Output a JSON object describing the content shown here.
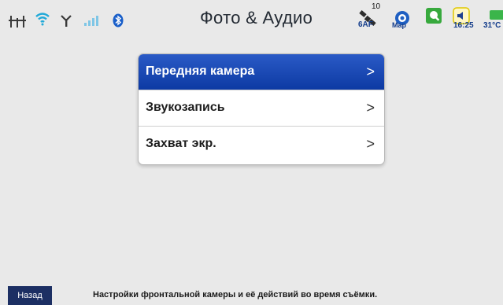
{
  "statusbar": {
    "title": "Фото & Аудио",
    "icons": {
      "ethernet": "ethernet-icon",
      "wifi": "wifi-icon",
      "antenna": "antenna-icon",
      "signal": "signal-icon",
      "bluetooth": "bluetooth-icon",
      "satellite": "satellite-icon",
      "map": "map-icon",
      "app": "green-app-icon",
      "volume": "volume-icon",
      "battery": "battery-icon"
    },
    "satellite_count": "10",
    "satellite_label": "6AF",
    "map_label": "Map",
    "time": "16:25",
    "temperature": "31°C"
  },
  "menu": {
    "items": [
      {
        "label": "Передняя камера",
        "chevron": ">"
      },
      {
        "label": "Звукозапись",
        "chevron": ">"
      },
      {
        "label": "Захват экр.",
        "chevron": ">"
      }
    ],
    "active_index": 0
  },
  "footer": {
    "back_label": "Назад",
    "hint": "Настройки фронтальной камеры и её действий во время съёмки."
  },
  "colors": {
    "background": "#e9e9e9",
    "accent": "#1a47b3",
    "back_button": "#1c2f63",
    "status_text": "#123b8a"
  }
}
